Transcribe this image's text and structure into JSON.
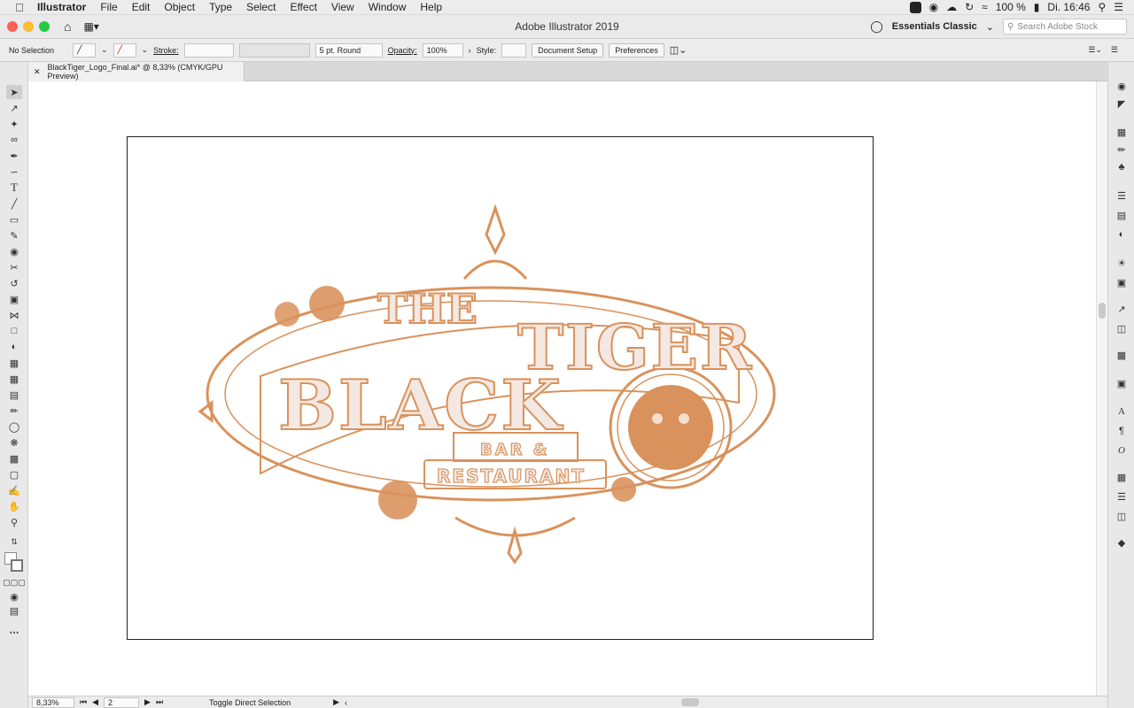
{
  "menubar": {
    "app_name": "Illustrator",
    "items": [
      "File",
      "Edit",
      "Object",
      "Type",
      "Select",
      "Effect",
      "View",
      "Window",
      "Help"
    ],
    "battery": "100 %",
    "clock": "Di. 16:46"
  },
  "window": {
    "title": "Adobe Illustrator 2019",
    "workspace": "Essentials Classic",
    "search_placeholder": "Search Adobe Stock"
  },
  "control_bar": {
    "selection": "No Selection",
    "stroke_label": "Stroke:",
    "brush": "5 pt. Round",
    "opacity_label": "Opacity:",
    "opacity_value": "100%",
    "style_label": "Style:",
    "document_setup": "Document Setup",
    "preferences": "Preferences"
  },
  "document": {
    "tab_title": "BlackTiger_Logo_Final.ai* @ 8,33% (CMYK/GPU Preview)"
  },
  "artwork": {
    "line1": "THE",
    "line2": "BLACK",
    "line3": "TIGER",
    "line4": "BAR &",
    "line5": "RESTAURANT",
    "color": "#d9925c"
  },
  "status": {
    "zoom": "8,33%",
    "artboard": "2",
    "message": "Toggle Direct Selection"
  }
}
